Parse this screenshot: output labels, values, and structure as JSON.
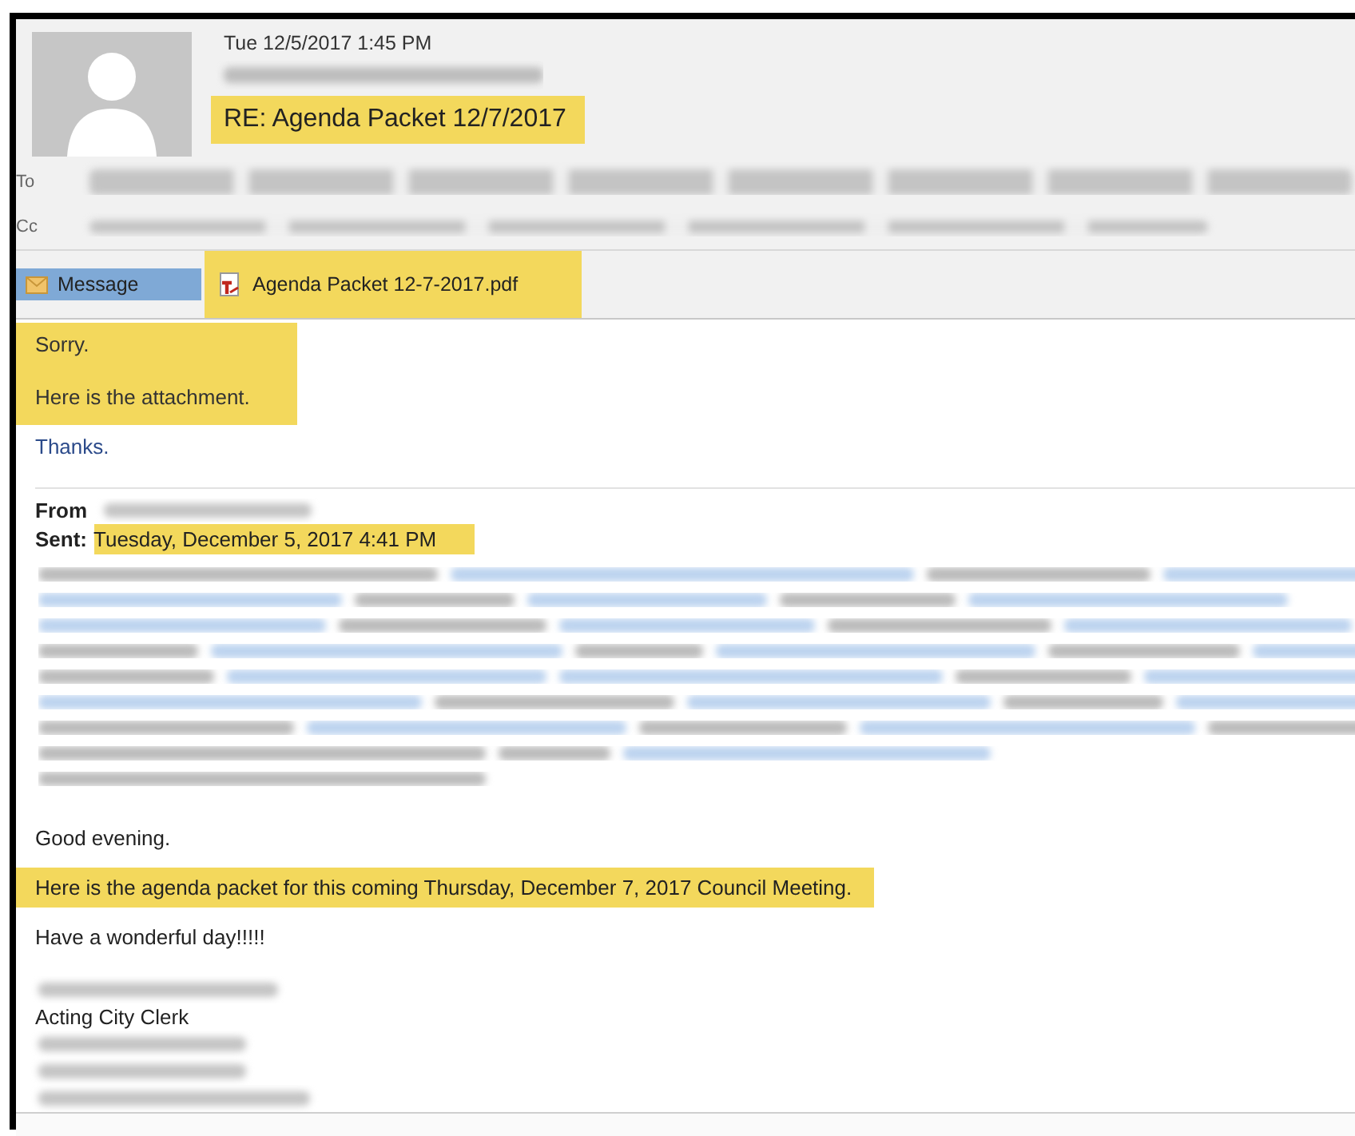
{
  "header": {
    "date": "Tue 12/5/2017 1:45 PM",
    "subject": {
      "text": "RE: Agenda Packet 12/7/2017",
      "highlighted": true
    },
    "to_label": "To",
    "cc_label": "Cc"
  },
  "attachments": [
    {
      "label": "Message",
      "kind": "message",
      "selected": true,
      "highlighted": false
    },
    {
      "label": "Agenda Packet 12-7-2017.pdf",
      "kind": "pdf",
      "selected": false,
      "highlighted": true
    }
  ],
  "reply": [
    {
      "lines": [
        "Sorry.",
        "Here is the attachment."
      ],
      "highlighted": true,
      "color": "#333333"
    },
    {
      "lines": [
        "Thanks."
      ],
      "highlighted": false,
      "color": "#2b4a8a"
    }
  ],
  "forwarded": {
    "from_label": "From",
    "sent_label": "Sent:",
    "sent_value": {
      "text": "Tuesday, December 5, 2017 4:41 PM",
      "highlighted": true
    }
  },
  "body": [
    {
      "kind": "text",
      "text": "Good evening.",
      "highlighted": false
    },
    {
      "kind": "text",
      "text": "Here is the agenda packet for this coming Thursday, December 7, 2017 Council Meeting.",
      "highlighted": true
    },
    {
      "kind": "text",
      "text": "Have a wonderful day!!!!!",
      "highlighted": false
    }
  ],
  "signature": [
    {
      "kind": "redacted"
    },
    {
      "kind": "text",
      "text": "Acting City Clerk"
    },
    {
      "kind": "redacted"
    },
    {
      "kind": "redacted"
    },
    {
      "kind": "redacted"
    }
  ]
}
